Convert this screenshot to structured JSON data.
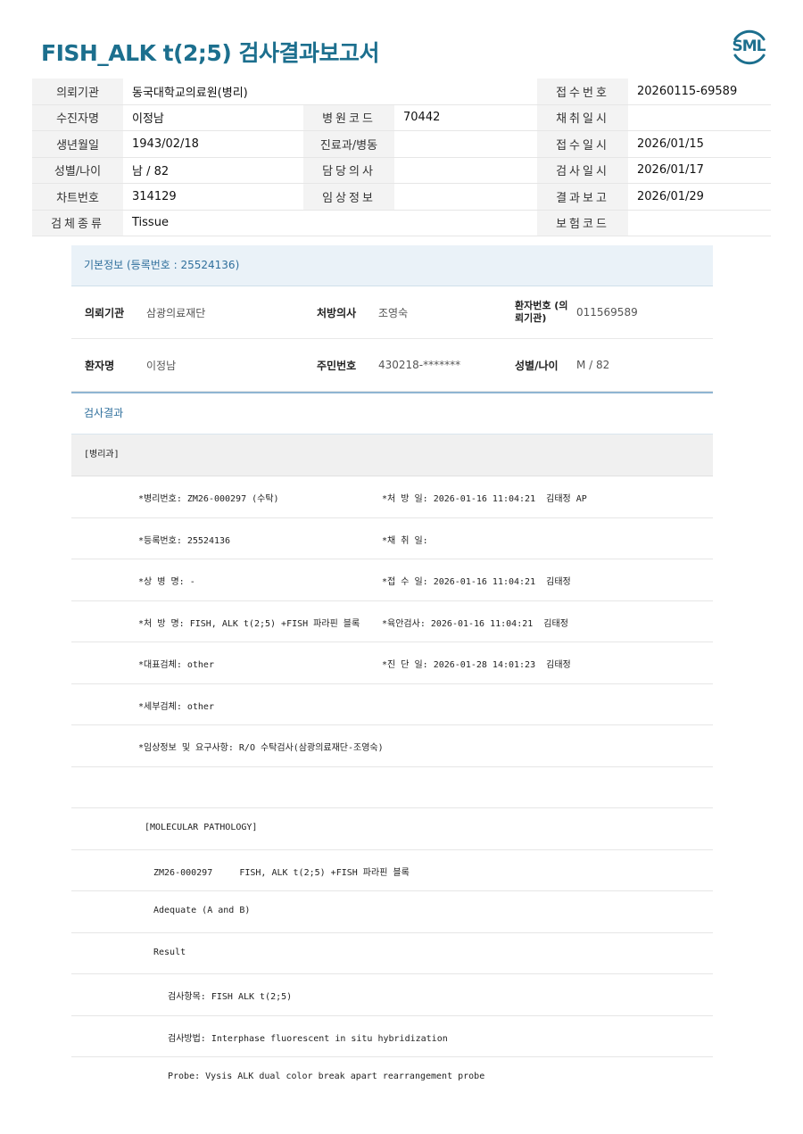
{
  "title": "FISH_ALK t(2;5) 검사결과보고서",
  "logo_text": "SML",
  "header": {
    "rows": [
      {
        "l1": "의뢰기관",
        "v1": "동국대학교의료원(병리)",
        "l2": "",
        "v2": "",
        "l3": "접수번호",
        "v3": "20260115-69589"
      },
      {
        "l1": "수진자명",
        "v1": "이정남",
        "l2": "병원코드",
        "v2": "70442",
        "l3": "채취일시",
        "v3": ""
      },
      {
        "l1": "생년월일",
        "v1": "1943/02/18",
        "l2": "진료과/병동",
        "v2": "",
        "l3": "접수일시",
        "v3": "2026/01/15"
      },
      {
        "l1": "성별/나이",
        "v1": "남 / 82",
        "l2": "담당의사",
        "v2": "",
        "l3": "검사일시",
        "v3": "2026/01/17"
      },
      {
        "l1": "차트번호",
        "v1": "314129",
        "l2": "임상정보",
        "v2": "",
        "l3": "결과보고",
        "v3": "2026/01/29"
      },
      {
        "l1": "검체종류",
        "v1": "Tissue",
        "l2": "",
        "v2": "",
        "l3": "보험코드",
        "v3": ""
      }
    ]
  },
  "basic_info": {
    "heading": "기본정보 (등록번호 : 25524136)",
    "inst_label": "의뢰기관",
    "inst_value": "삼광의료재단",
    "doctor_label": "처방의사",
    "doctor_value": "조영숙",
    "ptno_label": "환자번호 (의뢰기관)",
    "ptno_value": "011569589",
    "name_label": "환자명",
    "name_value": "이정남",
    "rrn_label": "주민번호",
    "rrn_value": "430218-*******",
    "sexage_label": "성별/나이",
    "sexage_value": "M / 82"
  },
  "result": {
    "heading": "검사결과",
    "dept": "[병리과]",
    "rows": [
      {
        "a": "*병리번호: ZM26-000297 (수탁)",
        "b": "*처 방 일: 2026-01-16 11:04:21  김태정 AP"
      },
      {
        "a": "*등록번호: 25524136",
        "b": "*채 취 일:"
      },
      {
        "a": "*상 병 명: -",
        "b": "*접 수 일: 2026-01-16 11:04:21  김태정"
      },
      {
        "a": "*처 방 명: FISH, ALK t(2;5) +FISH 파라핀 블록",
        "b": "*육안검사: 2026-01-16 11:04:21  김태정"
      },
      {
        "a": "*대표검체: other",
        "b": "*진 단 일: 2026-01-28 14:01:23  김태정"
      },
      {
        "a": "*세부검체: other",
        "b": ""
      },
      {
        "a": "*임상정보 및 요구사항: R/O 수탁검사(삼광의료재단-조영숙)",
        "b": ""
      },
      {
        "a": "",
        "b": ""
      }
    ],
    "lines": [
      {
        "indent": "l1",
        "text": "[MOLECULAR PATHOLOGY]"
      },
      {
        "indent": "l2",
        "text": "ZM26-000297     FISH, ALK t(2;5) +FISH 파라핀 블록"
      },
      {
        "indent": "l2",
        "text": "Adequate (A and B)"
      },
      {
        "indent": "l2",
        "text": "Result"
      },
      {
        "indent": "l3",
        "text": "검사항목: FISH ALK t(2;5)"
      },
      {
        "indent": "l3",
        "text": "검사방법: Interphase fluorescent in situ hybridization"
      },
      {
        "indent": "l3",
        "text": "Probe: Vysis ALK dual color break apart rearrangement probe"
      }
    ]
  }
}
